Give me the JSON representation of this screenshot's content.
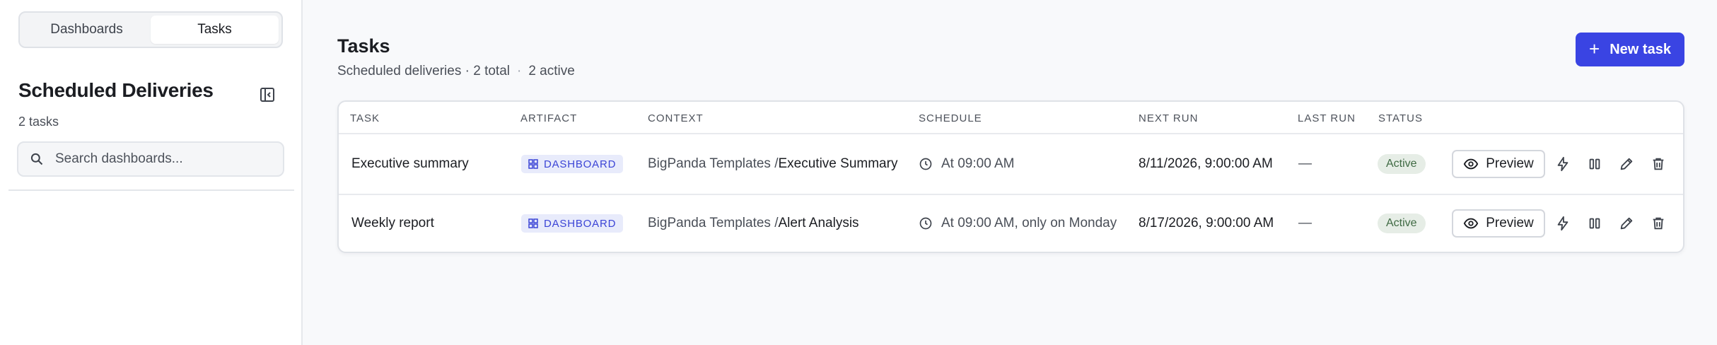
{
  "sidebar": {
    "tabs": [
      {
        "label": "Dashboards",
        "active": false
      },
      {
        "label": "Tasks",
        "active": true
      }
    ],
    "title": "Scheduled Deliveries",
    "count": "2 tasks",
    "search": {
      "placeholder": "Search dashboards...",
      "value": ""
    },
    "collapse_icon": "sidebar-collapse-icon"
  },
  "main": {
    "title": "Tasks",
    "subtitle": {
      "left": "Scheduled deliveries · 2 total",
      "right": "2 active"
    },
    "new_task_button": {
      "label": "New task",
      "icon": "plus-icon"
    },
    "table": {
      "columns": [
        "Task",
        "Artifact",
        "Context",
        "Schedule",
        "Next run",
        "Last run",
        "Status"
      ],
      "rows": [
        {
          "task": "Executive summary",
          "artifact": "DASHBOARD",
          "context_prefix": "BigPanda Templates /",
          "context_name": "Executive Summary",
          "schedule": "At 09:00 AM",
          "next_run": "8/11/2026, 9:00:00 AM",
          "last_run": "—",
          "status": "Active",
          "preview_label": "Preview"
        },
        {
          "task": "Weekly report",
          "artifact": "DASHBOARD",
          "context_prefix": "BigPanda Templates /",
          "context_name": "Alert Analysis",
          "schedule": "At 09:00 AM, only on Monday",
          "next_run": "8/17/2026, 9:00:00 AM",
          "last_run": "—",
          "status": "Active",
          "preview_label": "Preview"
        }
      ]
    },
    "row_action_icons": [
      "eye-icon",
      "lightning-icon",
      "pause-icon",
      "pencil-icon",
      "trash-icon"
    ]
  },
  "colors": {
    "accent": "#3a44e3",
    "artifact_badge_bg": "#e8ebfb",
    "artifact_badge_text": "#3b44d6",
    "status_active_bg": "#e6ede6",
    "status_active_text": "#3f6a43"
  }
}
